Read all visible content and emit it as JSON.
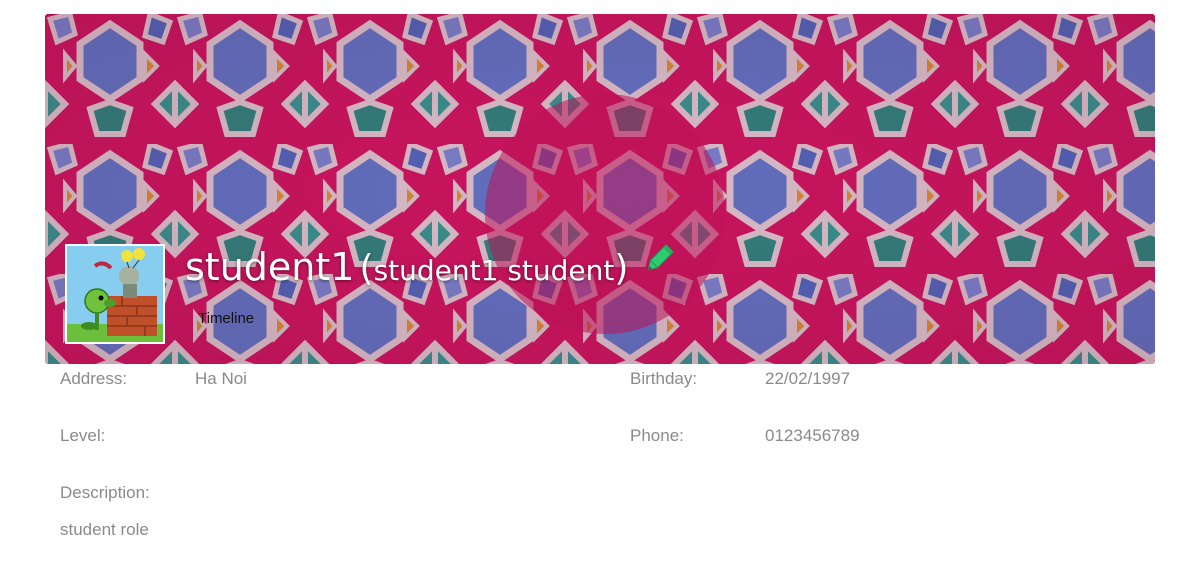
{
  "profile": {
    "username": "student1",
    "full_name": "student1 student",
    "open_paren": "(",
    "close_paren": ")",
    "timeline_label": "Timeline"
  },
  "icons": {
    "edit": "pencil-icon",
    "avatar": "plants-vs-zombies-avatar"
  },
  "info": {
    "address_label": "Address:",
    "address_value": "Ha Noi",
    "birthday_label": "Birthday:",
    "birthday_value": "22/02/1997",
    "level_label": "Level:",
    "level_value": "",
    "phone_label": "Phone:",
    "phone_value": "0123456789",
    "description_label": "Description:",
    "description_value": "student role"
  },
  "colors": {
    "pencil": "#2ecc71",
    "cover_base": "#c0135a",
    "text_muted": "#8a8a8a"
  }
}
